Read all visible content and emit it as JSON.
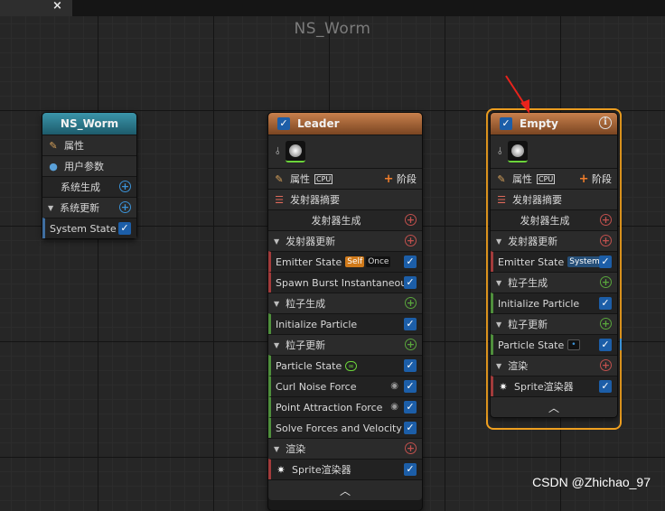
{
  "window": {
    "tab_close": "×",
    "graph_title": "NS_Worm"
  },
  "system_node": {
    "title": "NS_Worm",
    "rows": {
      "properties": "属性",
      "user_params": "用户参数",
      "system_spawn": "系统生成",
      "system_update": "系统更新",
      "system_state": "System State"
    }
  },
  "leader_node": {
    "title": "Leader",
    "properties": "属性",
    "sim_target": "CPU",
    "stage_button": "阶段",
    "emitter_summary": "发射器摘要",
    "emitter_spawn": "发射器生成",
    "emitter_update": "发射器更新",
    "emitter_state": "Emitter State",
    "badge_self": "Self",
    "badge_once": "Once",
    "spawn_burst": "Spawn Burst Instantaneous",
    "particle_spawn": "粒子生成",
    "initialize_particle": "Initialize Particle",
    "particle_update": "粒子更新",
    "particle_state": "Particle State",
    "curl_noise": "Curl Noise Force",
    "point_attraction": "Point Attraction Force",
    "solve_forces": "Solve Forces and Velocity",
    "render": "渲染",
    "sprite_renderer": "Sprite渲染器"
  },
  "empty_node": {
    "title": "Empty",
    "properties": "属性",
    "sim_target": "CPU",
    "stage_button": "阶段",
    "emitter_summary": "发射器摘要",
    "emitter_spawn": "发射器生成",
    "emitter_update": "发射器更新",
    "emitter_state": "Emitter State",
    "badge_system": "System",
    "particle_spawn": "粒子生成",
    "initialize_particle": "Initialize Particle",
    "particle_update": "粒子更新",
    "particle_state": "Particle State",
    "render": "渲染",
    "sprite_renderer": "Sprite渲染器"
  },
  "watermark": "CSDN @Zhichao_97",
  "colors": {
    "system_header": "#3b95aa",
    "emitter_header": "#c8804c",
    "selection_outline": "#f0a020",
    "checkbox": "#1c5ea8",
    "annotation_arrow": "#e8231c"
  }
}
